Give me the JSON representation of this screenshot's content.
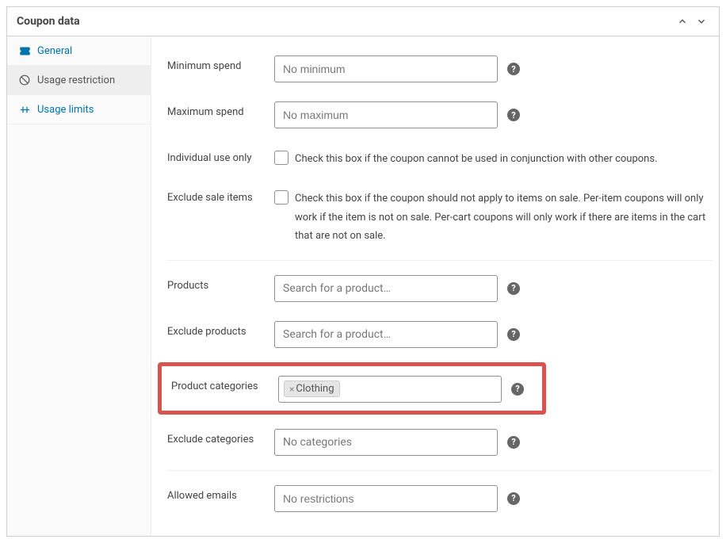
{
  "panel": {
    "title": "Coupon data"
  },
  "sidebar": {
    "items": [
      {
        "label": "General"
      },
      {
        "label": "Usage restriction"
      },
      {
        "label": "Usage limits"
      }
    ]
  },
  "fields": {
    "min_spend": {
      "label": "Minimum spend",
      "placeholder": "No minimum"
    },
    "max_spend": {
      "label": "Maximum spend",
      "placeholder": "No maximum"
    },
    "individual": {
      "label": "Individual use only",
      "desc": "Check this box if the coupon cannot be used in conjunction with other coupons."
    },
    "exclude_sale": {
      "label": "Exclude sale items",
      "desc": "Check this box if the coupon should not apply to items on sale. Per-item coupons will only work if the item is not on sale. Per-cart coupons will only work if there are items in the cart that are not on sale."
    },
    "products": {
      "label": "Products",
      "placeholder": "Search for a product…"
    },
    "exclude_products": {
      "label": "Exclude products",
      "placeholder": "Search for a product…"
    },
    "product_categories": {
      "label": "Product categories",
      "tags": [
        "Clothing"
      ]
    },
    "exclude_categories": {
      "label": "Exclude categories",
      "placeholder": "No categories"
    },
    "allowed_emails": {
      "label": "Allowed emails",
      "placeholder": "No restrictions"
    }
  }
}
